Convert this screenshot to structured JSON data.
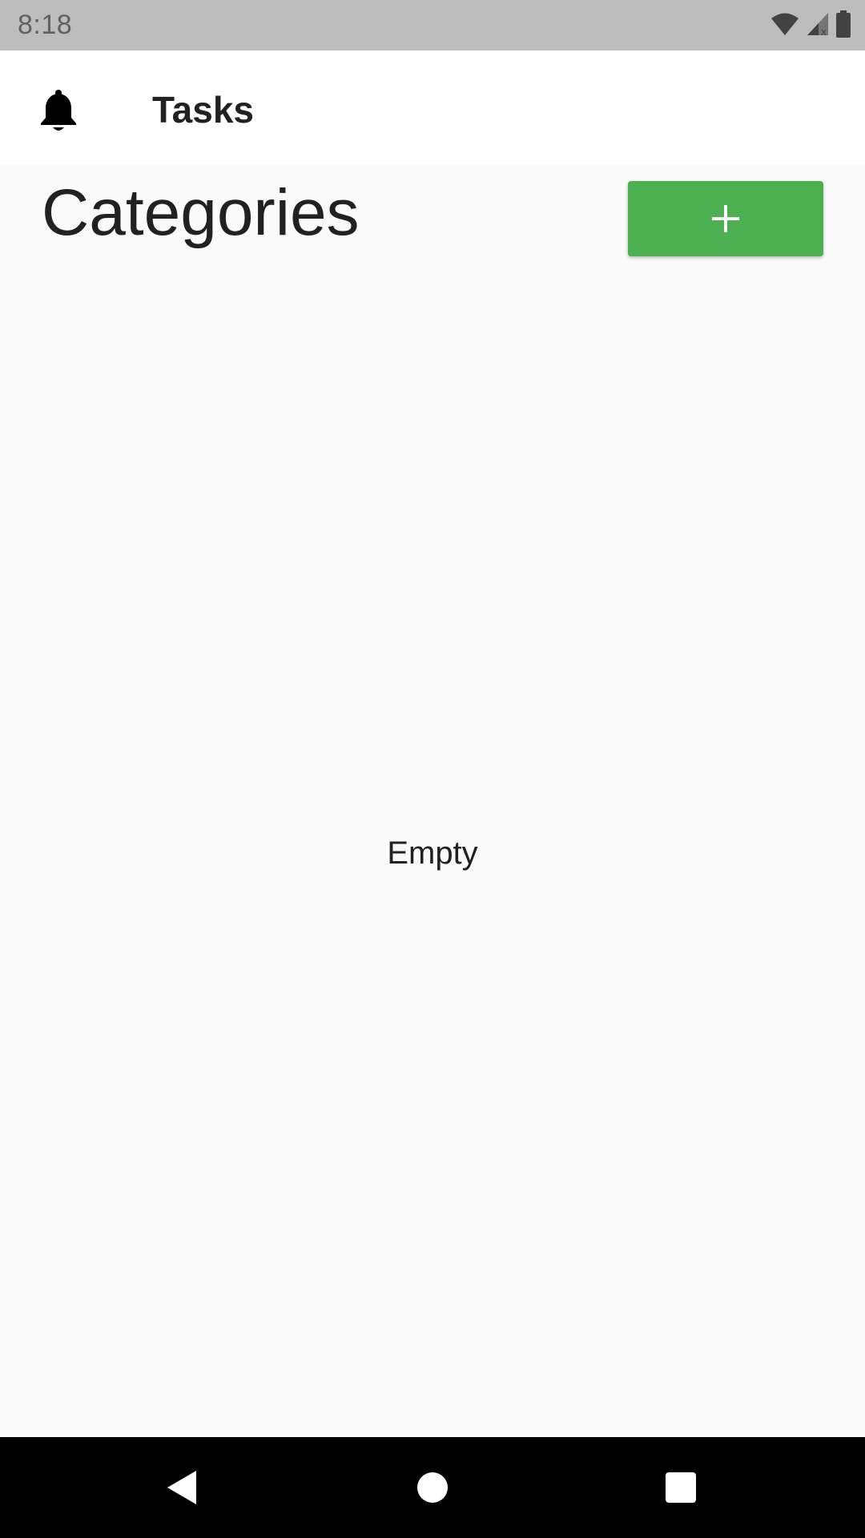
{
  "status_bar": {
    "time": "8:18",
    "icons": [
      "wifi-icon",
      "signal-icon",
      "battery-icon"
    ]
  },
  "app_bar": {
    "title": "Tasks",
    "icon": "bell-icon"
  },
  "header": {
    "title": "Categories",
    "add_button_icon": "plus-icon"
  },
  "main": {
    "empty_text": "Empty"
  },
  "nav_bar": {
    "buttons": [
      "back-icon",
      "home-icon",
      "recents-icon"
    ]
  },
  "colors": {
    "accent": "#4caf50",
    "background": "#fafafa",
    "app_bar": "#ffffff",
    "status_bar": "#bdbdbd",
    "nav_bar": "#000000"
  }
}
